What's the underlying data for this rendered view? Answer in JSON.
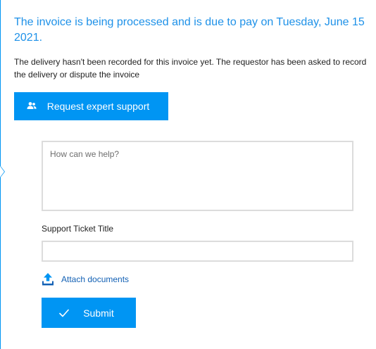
{
  "status": {
    "headline": "The invoice is being processed and is due to pay on Tuesday, June 15 2021.",
    "description": "The delivery hasn't been recorded for this invoice yet. The requestor has been asked to record the delivery or dispute the invoice"
  },
  "support": {
    "button_label": "Request expert support",
    "button_icon": "people-icon"
  },
  "form": {
    "help_placeholder": "How can we help?",
    "help_value": "",
    "ticket_title_label": "Support Ticket Title",
    "ticket_title_value": "",
    "attach_label": "Attach documents",
    "attach_icon": "upload-icon",
    "submit_label": "Submit",
    "submit_icon": "checkmark-icon"
  },
  "colors": {
    "accent": "#0095f3",
    "headline": "#1e91e8",
    "link": "#1260b4",
    "field_border": "#dcdcdc"
  }
}
